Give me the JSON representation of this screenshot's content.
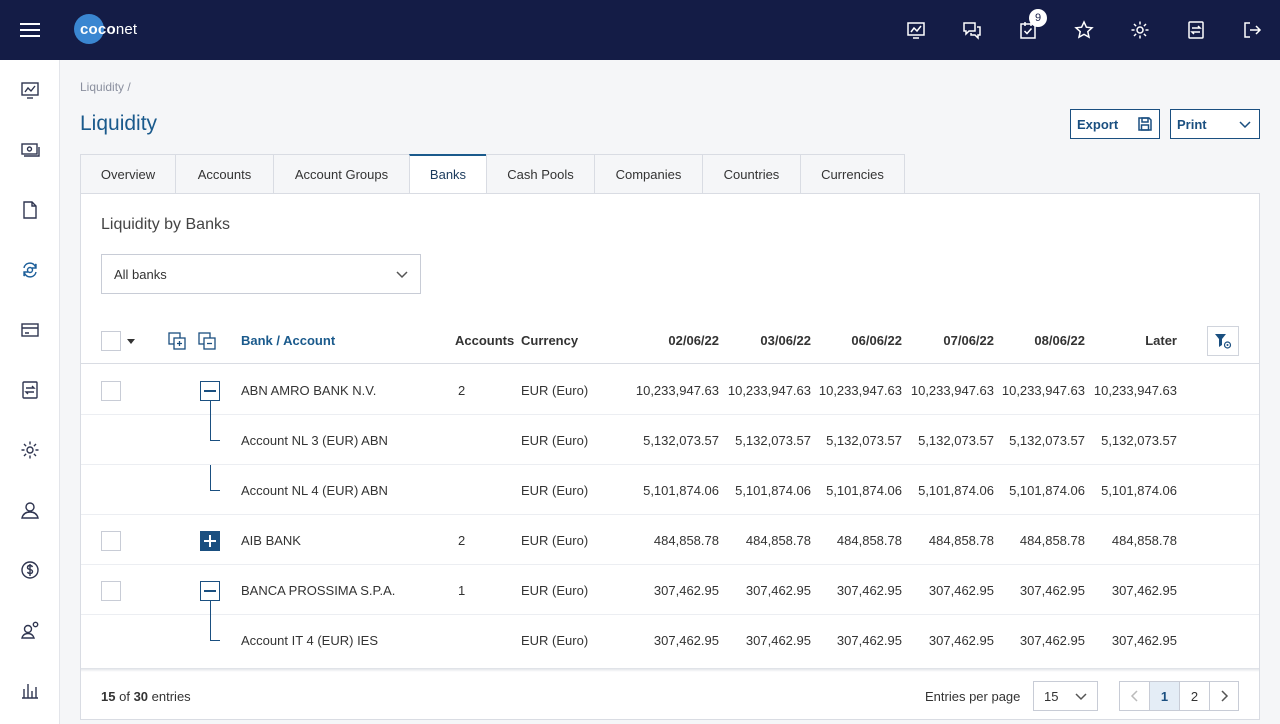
{
  "header": {
    "logo_text_a": "coco",
    "logo_text_b": "net",
    "notifications_count": "9",
    "icons": [
      "dashboard-icon",
      "chat-icon",
      "tasks-icon",
      "star-icon",
      "settings-icon",
      "transfer-icon",
      "logout-icon"
    ]
  },
  "sidebar": {
    "icons": [
      "dashboard-icon",
      "payments-icon",
      "document-icon",
      "liquidity-icon",
      "card-icon",
      "report-icon",
      "settings-icon",
      "user-icon",
      "currency-icon",
      "admin-icon",
      "chart-icon"
    ]
  },
  "breadcrumb": "Liquidity  /",
  "page_title": "Liquidity",
  "actions": {
    "export_label": "Export",
    "print_label": "Print"
  },
  "tabs": [
    {
      "label": "Overview"
    },
    {
      "label": "Accounts"
    },
    {
      "label": "Account Groups"
    },
    {
      "label": "Banks"
    },
    {
      "label": "Cash Pools"
    },
    {
      "label": "Companies"
    },
    {
      "label": "Countries"
    },
    {
      "label": "Currencies"
    }
  ],
  "active_tab": "Banks",
  "panel": {
    "title": "Liquidity by Banks",
    "bank_filter": "All banks"
  },
  "table": {
    "headers": {
      "bank_account": "Bank / Account",
      "accounts": "Accounts",
      "currency": "Currency",
      "d1": "02/06/22",
      "d2": "03/06/22",
      "d3": "06/06/22",
      "d4": "07/06/22",
      "d5": "08/06/22",
      "later": "Later"
    },
    "rows": [
      {
        "name": "ABN AMRO BANK N.V.",
        "accounts": "2",
        "currency": "EUR (Euro)",
        "v": [
          "10,233,947.63",
          "10,233,947.63",
          "10,233,947.63",
          "10,233,947.63",
          "10,233,947.63",
          "10,233,947.63"
        ]
      },
      {
        "name": "Account NL 3 (EUR) ABN",
        "accounts": "",
        "currency": "EUR (Euro)",
        "v": [
          "5,132,073.57",
          "5,132,073.57",
          "5,132,073.57",
          "5,132,073.57",
          "5,132,073.57",
          "5,132,073.57"
        ]
      },
      {
        "name": "Account NL 4 (EUR) ABN",
        "accounts": "",
        "currency": "EUR (Euro)",
        "v": [
          "5,101,874.06",
          "5,101,874.06",
          "5,101,874.06",
          "5,101,874.06",
          "5,101,874.06",
          "5,101,874.06"
        ]
      },
      {
        "name": "AIB BANK",
        "accounts": "2",
        "currency": "EUR (Euro)",
        "v": [
          "484,858.78",
          "484,858.78",
          "484,858.78",
          "484,858.78",
          "484,858.78",
          "484,858.78"
        ]
      },
      {
        "name": "BANCA PROSSIMA S.P.A.",
        "accounts": "1",
        "currency": "EUR (Euro)",
        "v": [
          "307,462.95",
          "307,462.95",
          "307,462.95",
          "307,462.95",
          "307,462.95",
          "307,462.95"
        ]
      },
      {
        "name": "Account IT 4 (EUR) IES",
        "accounts": "",
        "currency": "EUR (Euro)",
        "v": [
          "307,462.95",
          "307,462.95",
          "307,462.95",
          "307,462.95",
          "307,462.95",
          "307,462.95"
        ]
      }
    ]
  },
  "footer": {
    "shown": "15",
    "of_text": "of",
    "total": "30",
    "entries_text": "entries",
    "entries_per_page_label": "Entries per page",
    "entries_per_page_value": "15",
    "pages": [
      "1",
      "2"
    ],
    "current_page": "1"
  }
}
